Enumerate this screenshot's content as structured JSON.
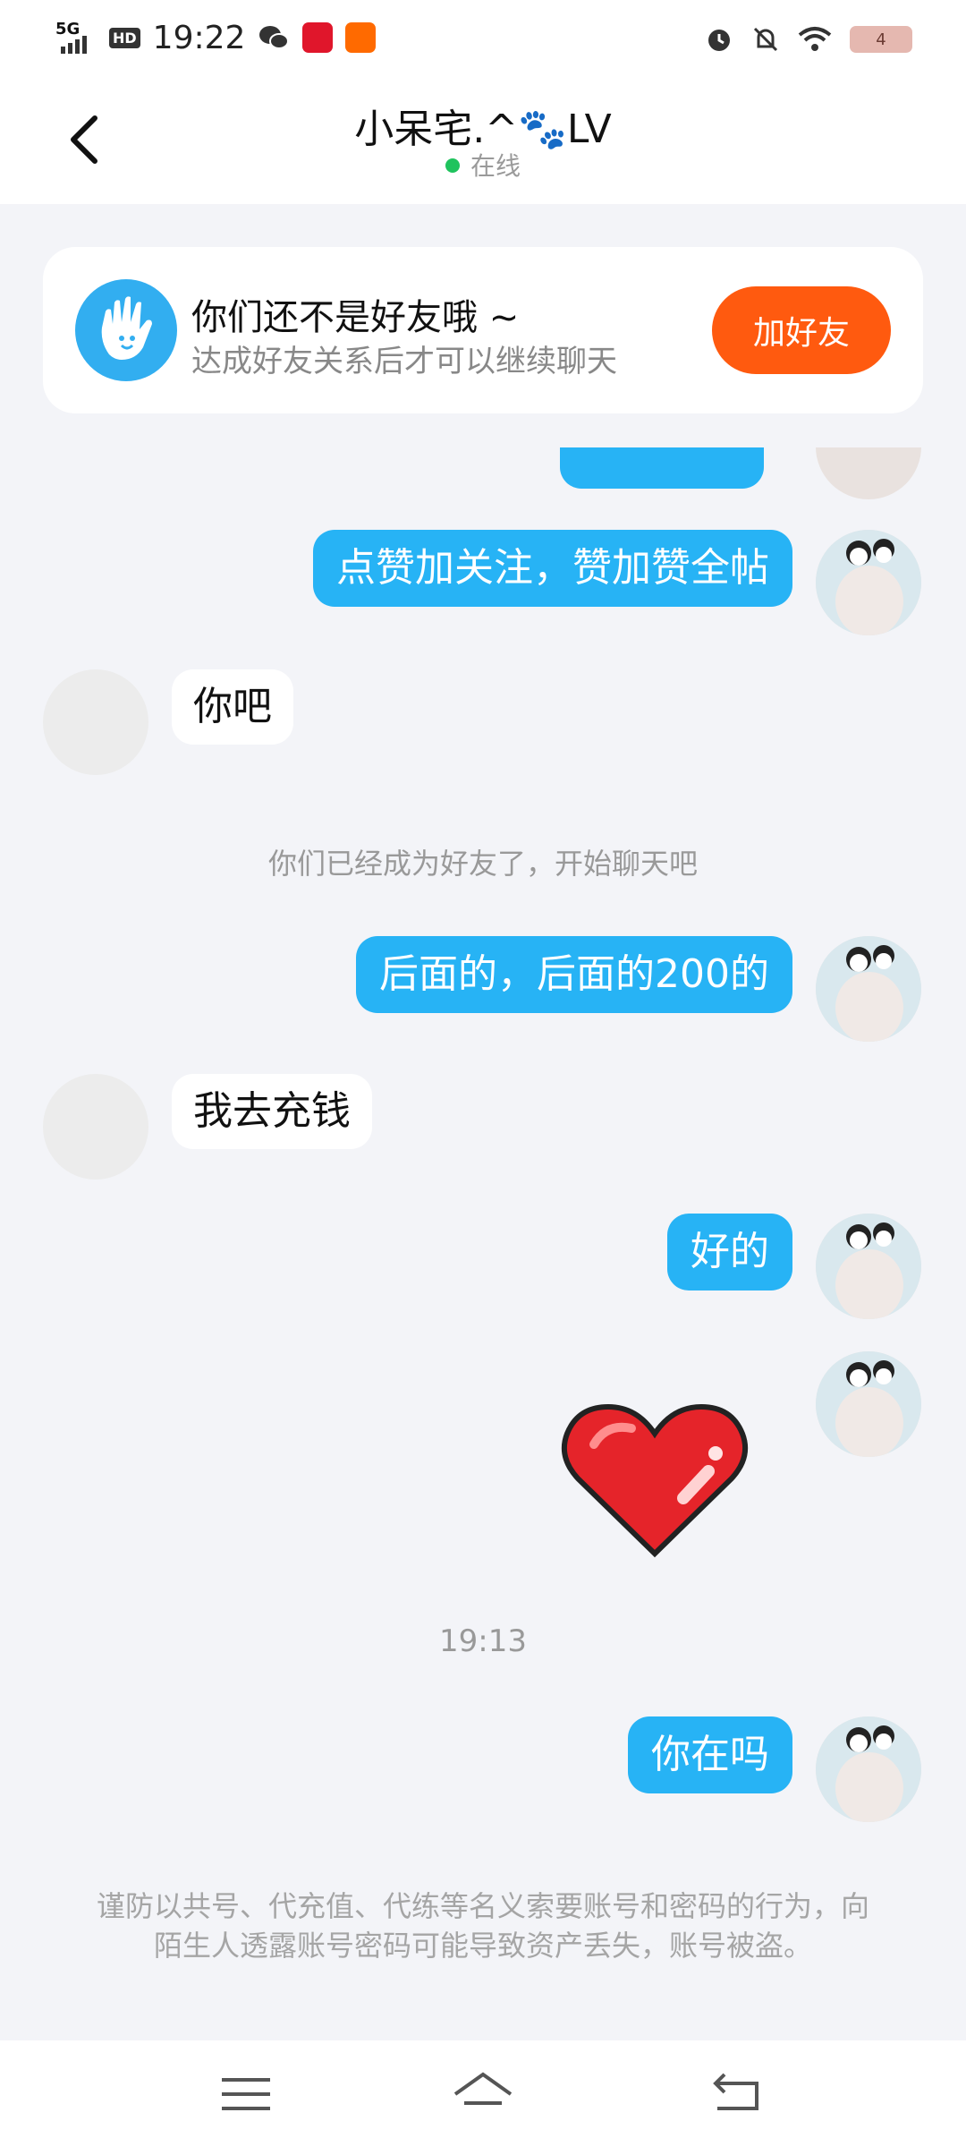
{
  "status_bar": {
    "network": "5G",
    "hd_badge": "HD",
    "time": "19:22",
    "battery_level": "4",
    "icons": [
      "signal-icon",
      "wechat-icon",
      "app-icon-red",
      "app-icon-orange",
      "alarm-icon",
      "bell-off-icon",
      "wifi-icon",
      "battery-icon"
    ]
  },
  "header": {
    "title": "小呆宅.^🐾LV",
    "status": "在线",
    "status_color": "#1fc35d"
  },
  "friend_card": {
    "title": "你们还不是好友哦 ~",
    "subtitle": "达成好友关系后才可以继续聊天",
    "button_label": "加好友",
    "button_color": "#ff5a0f"
  },
  "messages": [
    {
      "side": "right",
      "text": ""
    },
    {
      "side": "right",
      "text": "点赞加关注，赞加赞全帖"
    },
    {
      "side": "left",
      "text": "你吧"
    },
    {
      "side": "system",
      "text": "你们已经成为好友了，开始聊天吧"
    },
    {
      "side": "right",
      "text": "后面的，后面的200的"
    },
    {
      "side": "left",
      "text": "我去充钱"
    },
    {
      "side": "right",
      "text": "好的"
    },
    {
      "side": "right",
      "sticker": "heart-sticker"
    },
    {
      "side": "system",
      "text": "19:13"
    },
    {
      "side": "right",
      "text": "你在吗"
    }
  ],
  "warning": "谨防以共号、代充值、代练等名义索要账号和密码的行为，向陌生人透露账号密码可能导致资产丢失，账号被盗。",
  "colors": {
    "bubble_self": "#27b3f5",
    "page_bg": "#f3f4f8"
  }
}
